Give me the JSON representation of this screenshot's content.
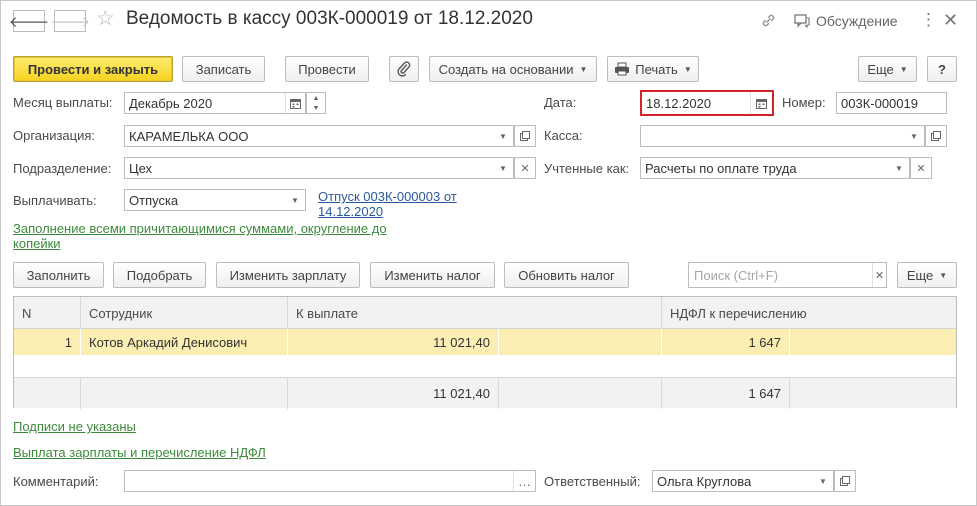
{
  "window": {
    "title": "Ведомость в кассу 003К-000019 от 18.12.2020",
    "discussion_label": "Обсуждение"
  },
  "toolbar": {
    "post_close_label": "Провести и закрыть",
    "save_label": "Записать",
    "post_label": "Провести",
    "create_based_label": "Создать на основании",
    "print_label": "Печать",
    "more_label": "Еще",
    "help_label": "?"
  },
  "form": {
    "month_label": "Месяц выплаты:",
    "month_value": "Декабрь 2020",
    "date_label": "Дата:",
    "date_value": "18.12.2020",
    "number_label": "Номер:",
    "number_value": "003К-000019",
    "org_label": "Организация:",
    "org_value": "КАРАМЕЛЬКА ООО",
    "cashbox_label": "Касса:",
    "cashbox_value": "",
    "dept_label": "Подразделение:",
    "dept_value": "Цех",
    "accounted_label": "Учтенные как:",
    "accounted_value": "Расчеты по оплате труда",
    "pay_label": "Выплачивать:",
    "pay_value": "Отпуска",
    "vacation_link_line1": "Отпуск 003К-000003 от",
    "vacation_link_line2": "14.12.2020",
    "fill_link_line1": "Заполнение всеми причитающимися суммами, округление до",
    "fill_link_line2": "копейки"
  },
  "table_toolbar": {
    "fill_label": "Заполнить",
    "pick_label": "Подобрать",
    "change_salary_label": "Изменить зарплату",
    "change_tax_label": "Изменить налог",
    "update_tax_label": "Обновить налог",
    "search_placeholder": "Поиск (Ctrl+F)",
    "more_label": "Еще"
  },
  "table": {
    "columns": [
      "N",
      "Сотрудник",
      "К выплате",
      "НДФЛ к перечислению"
    ],
    "rows": [
      {
        "n": "1",
        "employee": "Котов Аркадий Денисович",
        "to_pay": "11 021,40",
        "ndfl": "1 647"
      }
    ],
    "totals": {
      "to_pay": "11 021,40",
      "ndfl": "1 647"
    }
  },
  "footer": {
    "signatures_link": "Подписи не указаны",
    "salary_link": "Выплата зарплаты и перечисление НДФЛ",
    "comment_label": "Комментарий:",
    "comment_value": "",
    "responsible_label": "Ответственный:",
    "responsible_value": "Ольга Круглова"
  },
  "colors": {
    "primary_button": "#f7d21f",
    "selected_row": "#fbeeb3",
    "highlight_border": "#d0262b",
    "link_blue": "#2a5a9c",
    "link_green": "#3d8a3d"
  },
  "icons": {
    "back": "arrow-left-icon",
    "forward": "arrow-right-icon",
    "favorite": "star-icon",
    "link": "link-icon",
    "discussion": "speech-bubble-icon",
    "menu": "more-vertical-icon",
    "close": "close-icon",
    "attach": "paperclip-icon",
    "print": "printer-icon",
    "calendar": "calendar-icon"
  }
}
